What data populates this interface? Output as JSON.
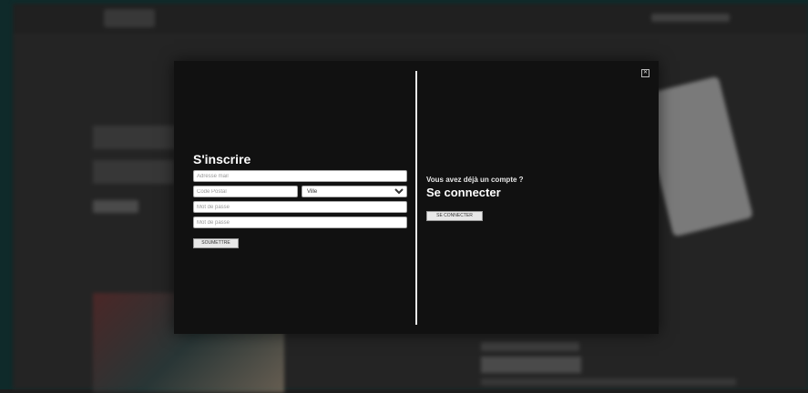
{
  "modal": {
    "close_icon": "close-icon"
  },
  "signup": {
    "title": "S'inscrire",
    "email_placeholder": "Adresse mail",
    "postal_placeholder": "Code Postal",
    "city_value": "Ville",
    "password_placeholder": "Mot de passe",
    "password_confirm_placeholder": "Mot de passe",
    "submit_label": "SOUMETTRE"
  },
  "login": {
    "subtitle": "Vous avez déjà un compte ?",
    "title": "Se connecter",
    "button_label": "SE CONNECTER"
  },
  "colors": {
    "modal_background": "#111111",
    "overlay_frame": "#0f2a2a"
  }
}
